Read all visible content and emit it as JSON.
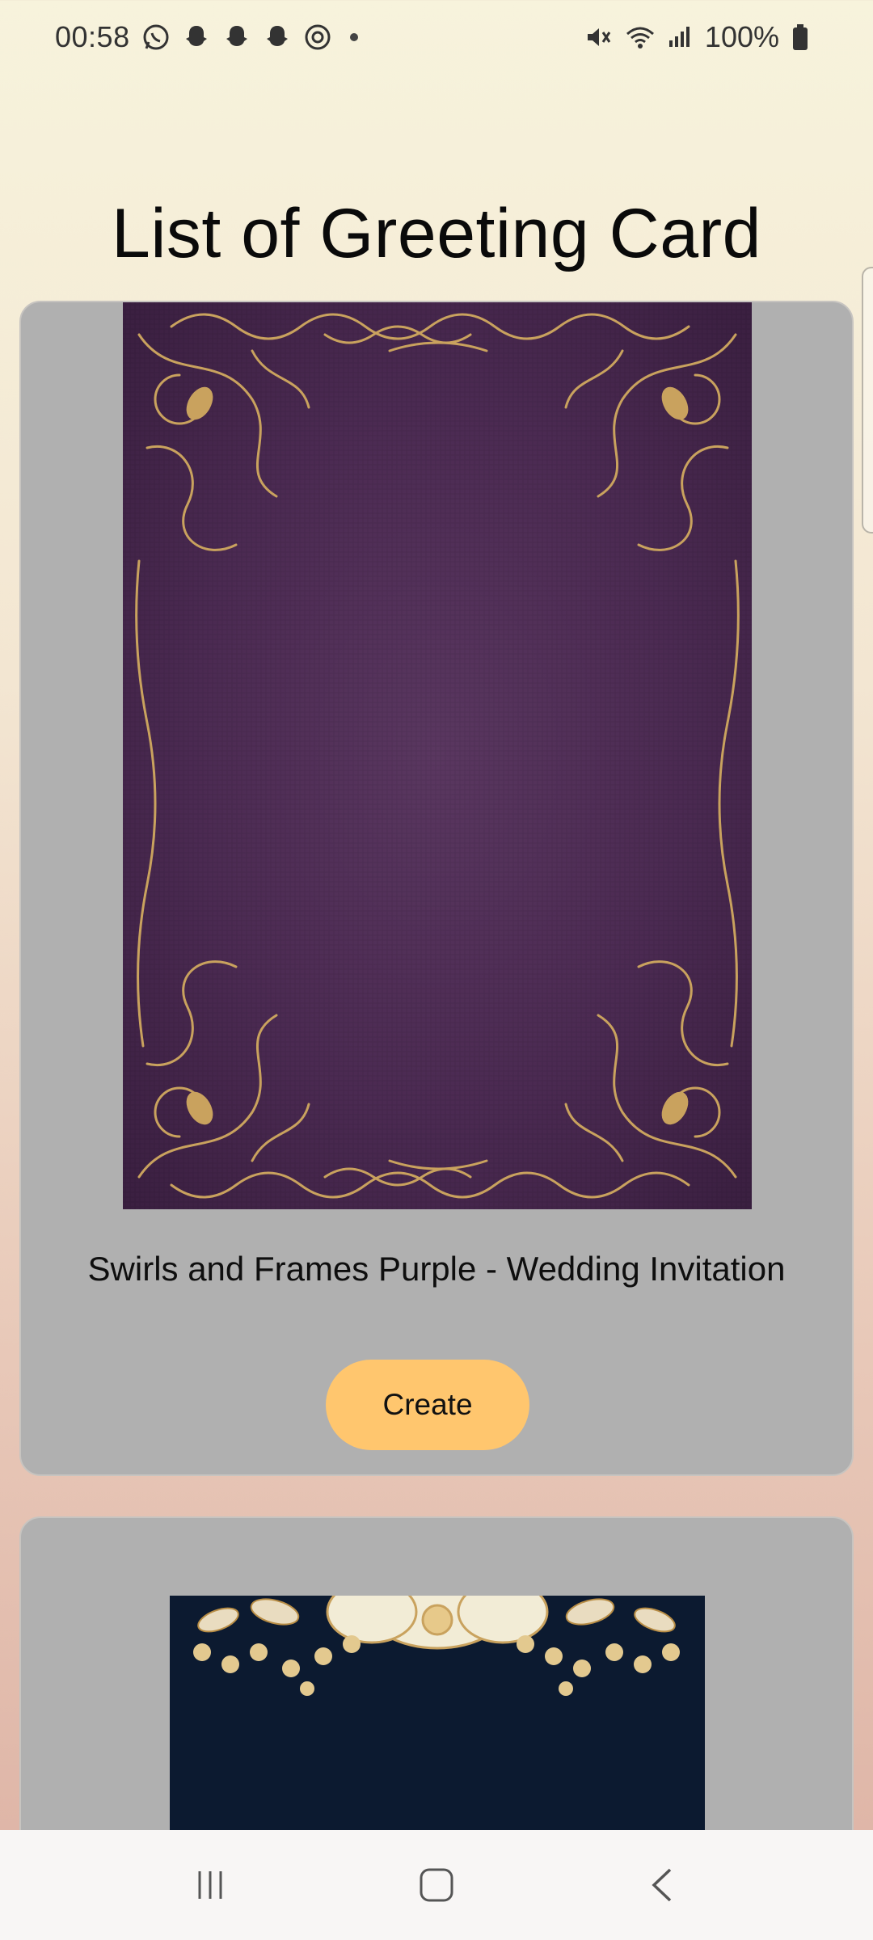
{
  "status_bar": {
    "time": "00:58",
    "battery": "100%",
    "left_icons": [
      "whatsapp-icon",
      "snapchat-icon",
      "snapchat-icon",
      "snapchat-icon",
      "threads-icon"
    ],
    "right_icons": [
      "mute-icon",
      "wifi-icon",
      "signal-icon",
      "battery-icon"
    ]
  },
  "page": {
    "title": "List of Greeting Card"
  },
  "cards": [
    {
      "title": "Swirls and Frames Purple - Wedding Invitation",
      "button_label": "Create",
      "image": "purple-swirl-frame"
    },
    {
      "title": "",
      "image": "navy-gold-floral"
    }
  ],
  "colors": {
    "card_bg": "#b0b0b0",
    "button_bg": "#ffc66e",
    "purple_card": "#4b2a52",
    "gold": "#c9a25e",
    "navy_card": "#0c1a30"
  },
  "nav": {
    "icons": [
      "recent-apps-icon",
      "home-icon",
      "back-icon"
    ]
  }
}
